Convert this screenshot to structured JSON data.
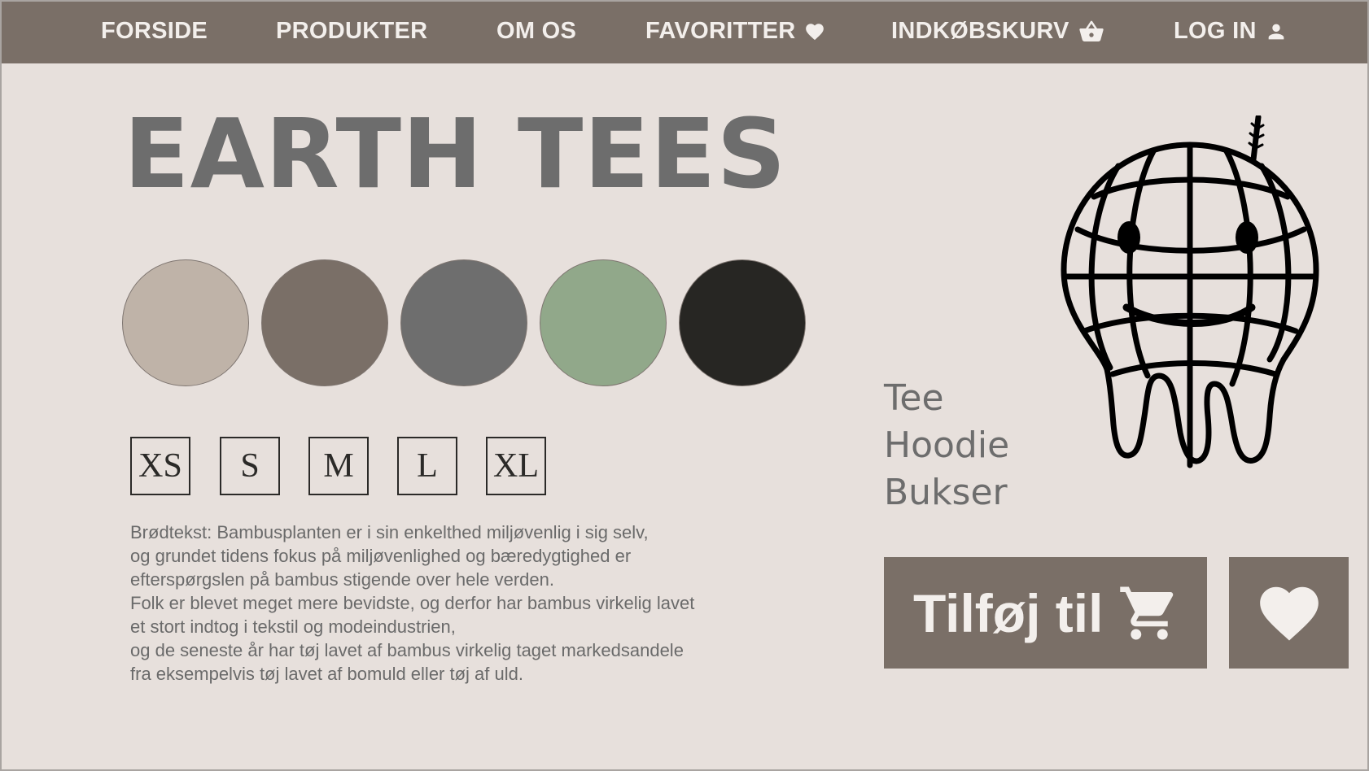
{
  "nav": {
    "items": [
      {
        "label": "FORSIDE",
        "icon": null
      },
      {
        "label": "PRODUKTER",
        "icon": null
      },
      {
        "label": "OM OS",
        "icon": null
      },
      {
        "label": "FAVORITTER",
        "icon": "heart-icon"
      },
      {
        "label": "INDKØBSKURV",
        "icon": "basket-icon"
      },
      {
        "label": "LOG IN",
        "icon": "user-icon"
      }
    ]
  },
  "product": {
    "title": "EARTH TEES",
    "colors": [
      "#bfb3a8",
      "#7a6f67",
      "#6e6e6e",
      "#91a88a",
      "#272623"
    ],
    "sizes": [
      "XS",
      "S",
      "M",
      "L",
      "XL"
    ],
    "description": [
      "Brødtekst: Bambusplanten er i sin enkelthed miljøvenlig i sig selv,",
      "og grundet tidens fokus på miljøvenlighed og bæredygtighed er",
      "efterspørgslen på bambus stigende over hele verden.",
      "Folk er blevet meget mere bevidste, og derfor har bambus virkelig lavet",
      "et stort indtog i tekstil og modeindustrien,",
      "og de seneste år har tøj lavet af bambus virkelig taget markedsandele",
      "fra eksempelvis tøj lavet af bomuld eller tøj af uld."
    ]
  },
  "categories": [
    "Tee",
    "Hoodie",
    "Bukser"
  ],
  "actions": {
    "add_label": "Tilføj til",
    "add_icon": "cart-icon",
    "favorite_icon": "heart-icon"
  },
  "theme": {
    "nav_bg": "#7a6f67",
    "page_bg": "#e7e0dc",
    "text_gray": "#6d6d6d"
  },
  "logo": {
    "icon": "melting-globe-logo"
  }
}
